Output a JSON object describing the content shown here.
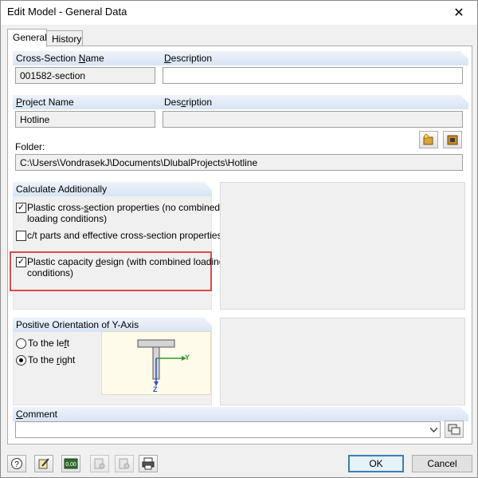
{
  "window": {
    "title": "Edit Model - General Data",
    "close": "✕"
  },
  "tabs": [
    {
      "label": "General"
    },
    {
      "label": "History"
    }
  ],
  "cross_section": {
    "header_prefix": "Cross-Section ",
    "header_u": "N",
    "header_suffix": "ame",
    "desc_header_prefix": "",
    "desc_header_u": "D",
    "desc_header_suffix": "escription",
    "name_value": "001582-section",
    "description_value": ""
  },
  "project": {
    "header_u": "P",
    "header_suffix": "roject Name",
    "desc_header_prefix": "Des",
    "desc_header_u": "c",
    "desc_header_suffix": "ription",
    "name_value": "Hotline",
    "description_value": "",
    "folder_label": "Folder:",
    "folder_value": "C:\\Users\\VondrasekJ\\Documents\\DlubalProjects\\Hotline"
  },
  "calculate": {
    "header": "Calculate Additionally",
    "opt1": {
      "label_a": "Plastic cross-",
      "label_u": "s",
      "label_b": "ection properties (no combined",
      "label_line2": "loading conditions)",
      "checked": true
    },
    "opt2": {
      "label": "c/t parts and effective cross-section properties",
      "checked": false
    },
    "opt3": {
      "label_a": "Plastic capacity ",
      "label_u": "d",
      "label_b": "esign (with combined loading",
      "label_line2": "conditions)",
      "checked": true
    }
  },
  "orientation": {
    "header": "Positive Orientation of Y-Axis",
    "left_label_a": "To the le",
    "left_label_u": "f",
    "left_label_b": "t",
    "right_label_a": "To the ",
    "right_label_u": "r",
    "right_label_b": "ight",
    "selected": "right",
    "axis_y": "Y",
    "axis_z": "Z"
  },
  "comment": {
    "header_u": "C",
    "header_suffix": "omment",
    "value": ""
  },
  "footer": {
    "ok": "OK",
    "cancel": "Cancel"
  },
  "checkmark": "✓",
  "colors": {
    "highlight": "#e04848",
    "section_header": "#d8e4f4",
    "default_button": "#3c7fb1"
  }
}
